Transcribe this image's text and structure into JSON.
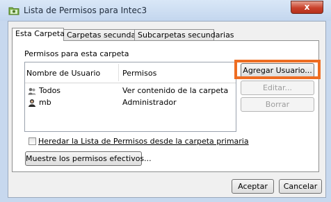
{
  "window": {
    "title": "Lista de Permisos para Intec3",
    "close_label": "x",
    "icon": "folder-permissions-icon"
  },
  "tabs": [
    {
      "label": "Esta Carpeta",
      "active": true
    },
    {
      "label": "Carpetas secundarias",
      "active": false
    },
    {
      "label": "Subcarpetas secundarias",
      "active": false
    }
  ],
  "panel": {
    "section_label": "Permisos para esta carpeta",
    "columns": {
      "user": "Nombre de Usuario",
      "permissions": "Permisos"
    },
    "rows": [
      {
        "icon": "group-icon",
        "user": "Todos",
        "permission": "Ver contenido de la carpeta"
      },
      {
        "icon": "user-icon",
        "user": "mb",
        "permission": "Administrador"
      }
    ],
    "buttons": {
      "add_user": "Agregar Usuario...",
      "edit": "Editar...",
      "delete": "Borrar"
    },
    "inherit_checkbox": {
      "label": "Heredar la Lista de Permisos desde la carpeta primaria",
      "checked": false
    },
    "effective_button": "Muestre los permisos efectivos..."
  },
  "footer": {
    "accept": "Aceptar",
    "cancel": "Cancelar"
  },
  "colors": {
    "highlight": "#ee6d22",
    "titlebar": "#c3d6ee",
    "close_button": "#c9412b"
  }
}
